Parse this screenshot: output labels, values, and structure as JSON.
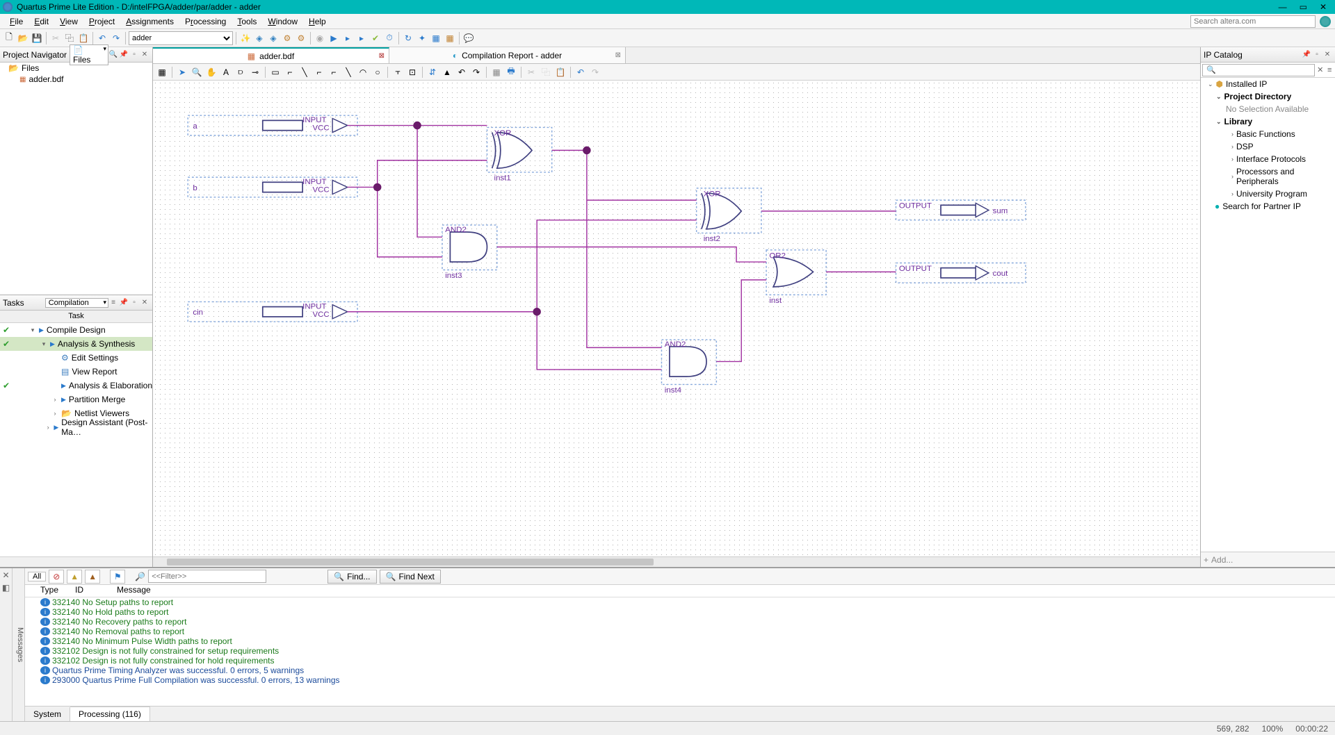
{
  "window": {
    "title": "Quartus Prime Lite Edition - D:/intelFPGA/adder/par/adder - adder",
    "search_placeholder": "Search altera.com"
  },
  "menu": {
    "items": [
      "File",
      "Edit",
      "View",
      "Project",
      "Assignments",
      "Processing",
      "Tools",
      "Window",
      "Help"
    ]
  },
  "toolbar": {
    "project_combo": "adder"
  },
  "project_nav": {
    "title": "Project Navigator",
    "view_combo": "Files",
    "root": "Files",
    "file": "adder.bdf"
  },
  "tasks": {
    "title": "Tasks",
    "combo": "Compilation",
    "header": "Task",
    "rows": [
      {
        "check": true,
        "indent": 0,
        "exp": "▾",
        "icon": "play",
        "label": "Compile Design"
      },
      {
        "check": true,
        "indent": 1,
        "exp": "▾",
        "icon": "play",
        "label": "Analysis & Synthesis",
        "selected": true
      },
      {
        "check": false,
        "indent": 2,
        "exp": "",
        "icon": "gear",
        "label": "Edit Settings"
      },
      {
        "check": false,
        "indent": 2,
        "exp": "",
        "icon": "report",
        "label": "View Report"
      },
      {
        "check": true,
        "indent": 2,
        "exp": "",
        "icon": "play",
        "label": "Analysis & Elaboration"
      },
      {
        "check": false,
        "indent": 2,
        "exp": "›",
        "icon": "play",
        "label": "Partition Merge"
      },
      {
        "check": false,
        "indent": 2,
        "exp": "›",
        "icon": "folder",
        "label": "Netlist Viewers"
      },
      {
        "check": false,
        "indent": 2,
        "exp": "›",
        "icon": "play",
        "label": "Design Assistant (Post-Ma…"
      }
    ]
  },
  "tabs": [
    {
      "label": "adder.bdf",
      "active": true,
      "icon": "bdf"
    },
    {
      "label": "Compilation Report - adder",
      "active": false,
      "icon": "report"
    }
  ],
  "schematic": {
    "inputs": [
      {
        "name": "a",
        "label": "INPUT",
        "sub": "VCC"
      },
      {
        "name": "b",
        "label": "INPUT",
        "sub": "VCC"
      },
      {
        "name": "cin",
        "label": "INPUT",
        "sub": "VCC"
      }
    ],
    "gates": [
      {
        "type": "XOR",
        "inst": "inst1"
      },
      {
        "type": "AND2",
        "inst": "inst3"
      },
      {
        "type": "XOR",
        "inst": "inst2"
      },
      {
        "type": "AND2",
        "inst": "inst4"
      },
      {
        "type": "OR2",
        "inst": "inst"
      }
    ],
    "outputs": [
      {
        "name": "sum",
        "label": "OUTPUT"
      },
      {
        "name": "cout",
        "label": "OUTPUT"
      }
    ]
  },
  "ipcatalog": {
    "title": "IP Catalog",
    "installed": "Installed IP",
    "projdir": "Project Directory",
    "nosel": "No Selection Available",
    "library": "Library",
    "cats": [
      "Basic Functions",
      "DSP",
      "Interface Protocols",
      "Processors and Peripherals",
      "University Program"
    ],
    "partner": "Search for Partner IP",
    "add": "Add..."
  },
  "messages": {
    "all_label": "All",
    "filter_placeholder": "<<Filter>>",
    "find_label": "Find...",
    "findnext_label": "Find Next",
    "header": {
      "c1": "Type",
      "c2": "ID",
      "c3": "Message"
    },
    "lines": [
      {
        "id": "332140",
        "txt": "No Setup paths to report",
        "cls": "grn"
      },
      {
        "id": "332140",
        "txt": "No Hold paths to report",
        "cls": "grn"
      },
      {
        "id": "332140",
        "txt": "No Recovery paths to report",
        "cls": "grn"
      },
      {
        "id": "332140",
        "txt": "No Removal paths to report",
        "cls": "grn"
      },
      {
        "id": "332140",
        "txt": "No Minimum Pulse Width paths to report",
        "cls": "grn"
      },
      {
        "id": "332102",
        "txt": "Design is not fully constrained for setup requirements",
        "cls": "grn"
      },
      {
        "id": "332102",
        "txt": "Design is not fully constrained for hold requirements",
        "cls": "grn"
      },
      {
        "id": "",
        "txt": "Quartus Prime Timing Analyzer was successful. 0 errors, 5 warnings",
        "cls": "blu",
        "indent": true
      },
      {
        "id": "293000",
        "txt": "Quartus Prime Full Compilation was successful. 0 errors, 13 warnings",
        "cls": "blu"
      }
    ],
    "tabs": [
      "System",
      "Processing (116)"
    ],
    "side_label": "Messages"
  },
  "statusbar": {
    "coord": "569, 282",
    "zoom": "100%",
    "time": "00:00:22"
  }
}
